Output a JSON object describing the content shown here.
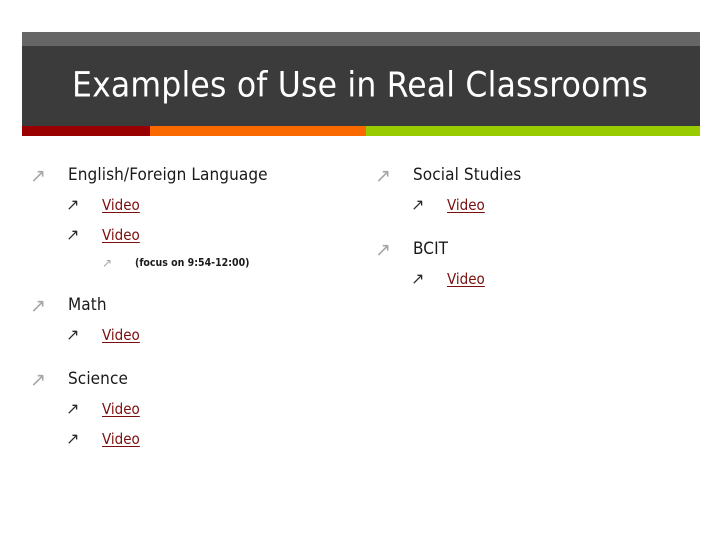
{
  "slide": {
    "title": "Examples of Use in Real Classrooms",
    "colors": {
      "header_top_band": "#666666",
      "header_main": "#3b3b3b",
      "accent_red": "#990000",
      "accent_orange": "#FA6800",
      "accent_green": "#99CC00",
      "link": "#7B0E0E",
      "bullet_level1": "#A6A6A6",
      "bullet_level2": "#2b2b2b",
      "text": "#1a1a1a",
      "background": "#FFFFFF"
    },
    "bullet_glyph": "↗"
  },
  "left_column": {
    "items": [
      {
        "label": "English/Foreign Language",
        "children": [
          {
            "label": "Video",
            "link": true,
            "children": []
          },
          {
            "label": "Video",
            "link": true,
            "children": [
              {
                "label": "(focus on 9:54-12:00)",
                "link": false
              }
            ]
          }
        ]
      },
      {
        "label": "Math",
        "children": [
          {
            "label": "Video",
            "link": true,
            "children": []
          }
        ]
      },
      {
        "label": "Science",
        "children": [
          {
            "label": "Video",
            "link": true,
            "children": []
          },
          {
            "label": "Video",
            "link": true,
            "children": []
          }
        ]
      }
    ]
  },
  "right_column": {
    "items": [
      {
        "label": "Social Studies",
        "children": [
          {
            "label": "Video",
            "link": true,
            "children": []
          }
        ]
      },
      {
        "label": "BCIT",
        "children": [
          {
            "label": "Video",
            "link": true,
            "children": []
          }
        ]
      }
    ]
  }
}
